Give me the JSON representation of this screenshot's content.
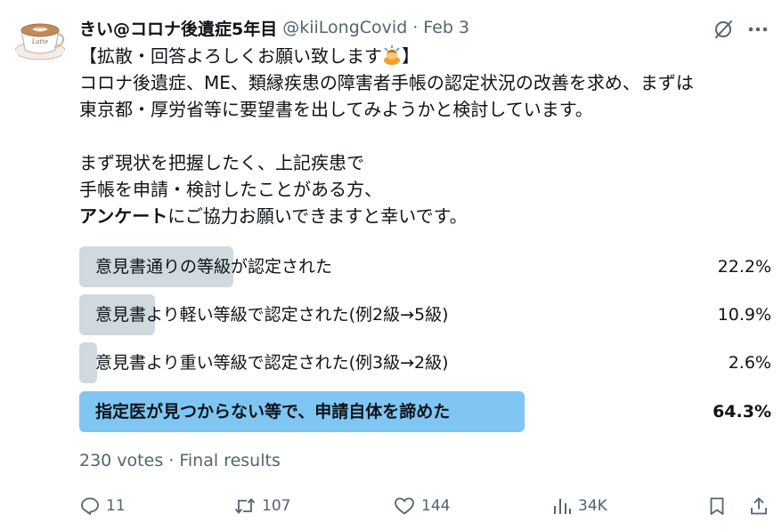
{
  "tweet": {
    "author": {
      "display_name": "きい@コロナ後遺症5年目",
      "handle": "@kiiLongCovid",
      "separator": "·",
      "date": "Feb 3",
      "avatar_logo_text": "Latte"
    },
    "body": {
      "line1_prefix": "【拡散・回答よろしくお願い致します",
      "line1_emoji": "person-bowing-emoji",
      "line1_suffix": "】",
      "line2": "コロナ後遺症、ME、類縁疾患の障害者手帳の認定状況の改善を求め、まずは",
      "line3": "東京都・厚労省等に要望書を出してみようかと検討しています。",
      "line5": "まず現状を把握したく、上記疾患で",
      "line6": "手帳を申請・検討したことがある方、",
      "line7_bold": "アンケート",
      "line7_rest": "にご協力お願いできますと幸いです。"
    },
    "poll": {
      "options": [
        {
          "label": "意見書通りの等級が認定された",
          "percent_text": "22.2%",
          "percent": 22.2,
          "winner": false
        },
        {
          "label": "意見書より軽い等級で認定された(例2級→5級)",
          "percent_text": "10.9%",
          "percent": 10.9,
          "winner": false
        },
        {
          "label": "意見書より重い等級で認定された(例3級→2級)",
          "percent_text": "2.6%",
          "percent": 2.6,
          "winner": false
        },
        {
          "label": "指定医が見つからない等で、申請自体を諦めた",
          "percent_text": "64.3%",
          "percent": 64.3,
          "winner": true
        }
      ],
      "votes": "230 votes",
      "separator": "·",
      "status": "Final results"
    },
    "actions": {
      "reply_count": "11",
      "repost_count": "107",
      "like_count": "144",
      "views_count": "34K"
    }
  },
  "icons": {
    "reply": "reply-icon",
    "repost": "repost-icon",
    "like": "heart-icon",
    "views": "views-icon",
    "bookmark": "bookmark-icon",
    "share": "share-icon",
    "grok": "grok-icon",
    "more": "more-icon"
  },
  "colors": {
    "text": "#0f1419",
    "secondary": "#536471",
    "poll_bar": "#cfd9de",
    "poll_winner_bar": "#7fc6f3"
  }
}
